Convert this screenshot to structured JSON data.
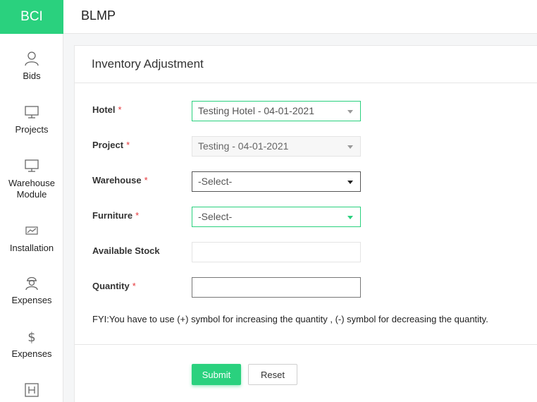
{
  "brand": "BCI",
  "app_title": "BLMP",
  "sidebar": {
    "items": [
      {
        "label": "Bids",
        "icon": "user-icon"
      },
      {
        "label": "Projects",
        "icon": "monitor-icon"
      },
      {
        "label": "Warehouse Module",
        "icon": "monitor-icon"
      },
      {
        "label": "Installation",
        "icon": "chart-icon"
      },
      {
        "label": "Expenses",
        "icon": "worker-icon"
      },
      {
        "label": "Expenses",
        "icon": "dollar-icon"
      },
      {
        "label": "",
        "icon": "hotel-icon"
      }
    ]
  },
  "form": {
    "title": "Inventory Adjustment",
    "required_mark": "*",
    "hotel": {
      "label": "Hotel",
      "value": "Testing Hotel - 04-01-2021"
    },
    "project": {
      "label": "Project",
      "value": "Testing - 04-01-2021"
    },
    "warehouse": {
      "label": "Warehouse",
      "value": "-Select-"
    },
    "furniture": {
      "label": "Furniture",
      "value": "-Select-"
    },
    "available_stock": {
      "label": "Available Stock",
      "value": ""
    },
    "quantity": {
      "label": "Quantity",
      "value": ""
    },
    "fyi": "FYI:You have to use (+) symbol for increasing the quantity , (-) symbol for decreasing the quantity.",
    "submit_label": "Submit",
    "reset_label": "Reset"
  },
  "colors": {
    "accent": "#2ad17e",
    "required": "#e5373b"
  }
}
